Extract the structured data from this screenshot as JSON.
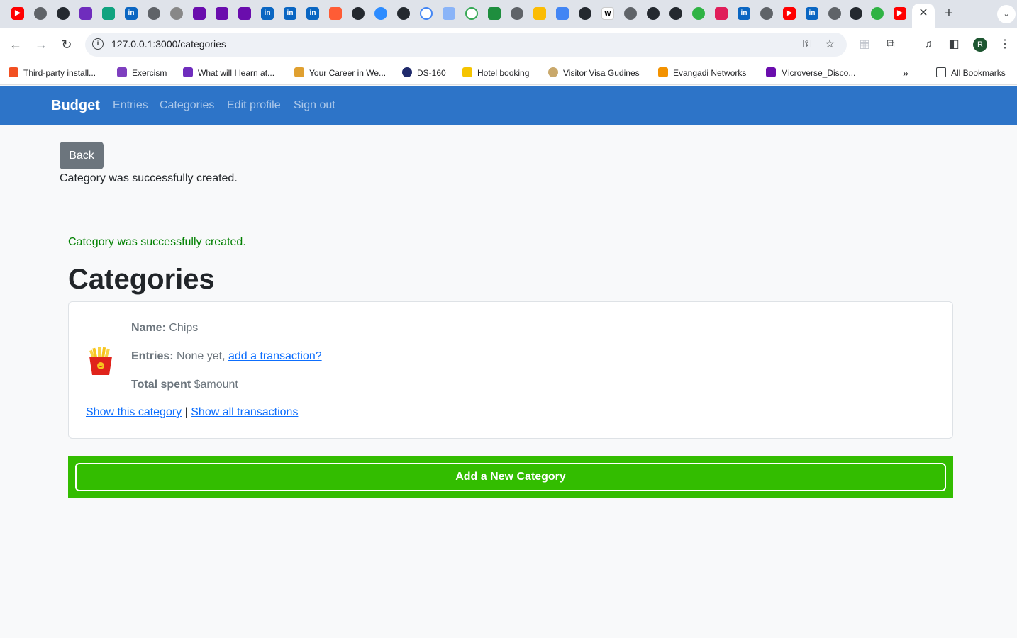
{
  "browser": {
    "url": "127.0.0.1:3000/categories",
    "tab_close": "✕",
    "new_tab": "+",
    "profile_initial": "R",
    "bookmarks": [
      {
        "label": "Third-party install...",
        "color": "#f25022"
      },
      {
        "label": "Exercism",
        "color": "#7e3fbf"
      },
      {
        "label": "What will I learn at...",
        "color": "#6f2dbd"
      },
      {
        "label": "Your Career in We...",
        "color": "#e0a030"
      },
      {
        "label": "DS-160",
        "color": "#1f2a6b"
      },
      {
        "label": "Hotel booking",
        "color": "#f5c400"
      },
      {
        "label": "Visitor Visa Gudines",
        "color": "#c9a86b"
      },
      {
        "label": "Evangadi Networks",
        "color": "#f39200"
      },
      {
        "label": "Microverse_Disco...",
        "color": "#6a0dad"
      }
    ],
    "all_bookmarks": "All Bookmarks"
  },
  "nav": {
    "brand": "Budget",
    "links": [
      "Entries",
      "Categories",
      "Edit profile",
      "Sign out"
    ]
  },
  "page": {
    "back_label": "Back",
    "notice_top": "Category was successfully created.",
    "notice_green": "Category was successfully created.",
    "title": "Categories"
  },
  "category": {
    "name_label": "Name:",
    "name": "Chips",
    "entries_label": "Entries:",
    "entries_text": "None yet,",
    "entries_link": "add a transaction?",
    "total_label": "Total spent",
    "total_value": "$amount",
    "show_link": "Show this category",
    "separator": "|",
    "all_link": "Show all transactions"
  },
  "actions": {
    "add_label": "Add a New Category",
    "add_bar_color": "#33bd00"
  }
}
